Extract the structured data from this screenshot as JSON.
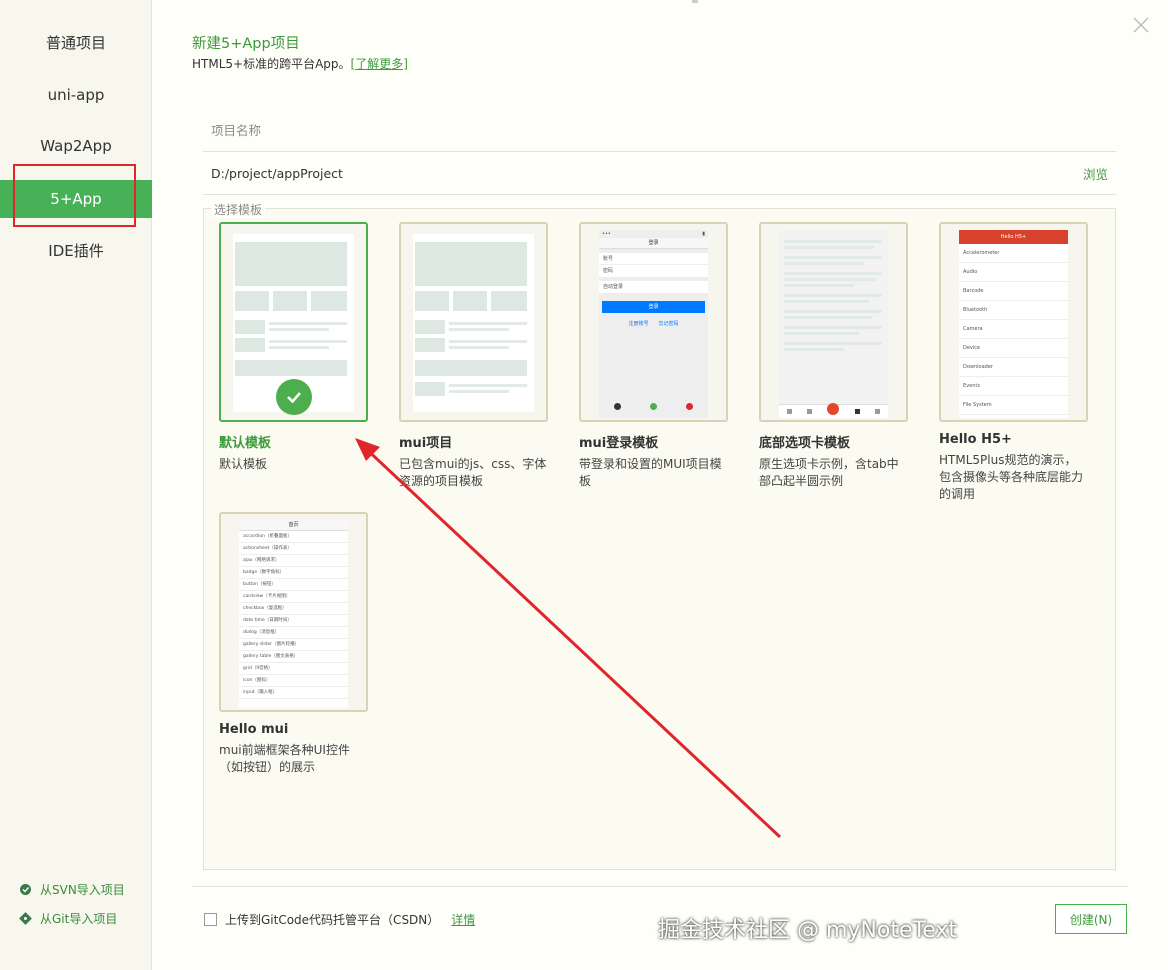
{
  "sidebar": {
    "items": [
      {
        "label": "普通项目"
      },
      {
        "label": "uni-app"
      },
      {
        "label": "Wap2App"
      },
      {
        "label": "5+App",
        "active": true
      },
      {
        "label": "IDE插件"
      }
    ],
    "imports": [
      {
        "label": "从SVN导入项目",
        "icon": "svn-icon"
      },
      {
        "label": "从Git导入项目",
        "icon": "git-icon"
      }
    ]
  },
  "header": {
    "title": "新建5+App项目",
    "subtitle": "HTML5+标准的跨平台App。",
    "learn_more": "[了解更多]"
  },
  "form": {
    "name_placeholder": "项目名称",
    "path_value": "D:/project/appProject",
    "browse_label": "浏览"
  },
  "templates": {
    "legend": "选择模板",
    "items": [
      {
        "name": "默认模板",
        "desc": "默认模板",
        "selected": true
      },
      {
        "name": "mui项目",
        "desc": "已包含mui的js、css、字体资源的项目模板"
      },
      {
        "name": "mui登录模板",
        "desc": "带登录和设置的MUI项目模板"
      },
      {
        "name": "底部选项卡模板",
        "desc": "原生选项卡示例，含tab中部凸起半圆示例"
      },
      {
        "name": "Hello H5+",
        "desc": "HTML5Plus规范的演示，包含摄像头等各种底层能力的调用"
      },
      {
        "name": "Hello mui",
        "desc": "mui前端框架各种UI控件（如按钮）的展示"
      }
    ],
    "login_thumb": {
      "title": "登录",
      "account": "账号",
      "password": "密码",
      "auto": "自动登录",
      "button": "登录",
      "register": "注册账号",
      "forgot": "忘记密码"
    },
    "h5_thumb": {
      "title": "Hello H5+",
      "rows": [
        "Accelerometer",
        "Audio",
        "Barcode",
        "Bluetooth",
        "Camera",
        "Device",
        "Downloader",
        "Events",
        "File System"
      ]
    },
    "mui_thumb": {
      "title": "首页",
      "rows": [
        "accordion（折叠面板）",
        "actionsheet（操作表）",
        "ajax（网络请求）",
        "badge（数字角标）",
        "button（按钮）",
        "cardview（卡片视图）",
        "checkbox（复选框）",
        "date time（日期时间）",
        "dialog（消息框）",
        "gallery slider（图片轮播）",
        "gallery table（图文表格）",
        "grid（9宫格）",
        "icon（图标）",
        "input（输入框）"
      ]
    }
  },
  "footer": {
    "gitcode_label": "上传到GitCode代码托管平台（CSDN）",
    "detail_link": "详情",
    "create_button": "创建(N)"
  },
  "watermark": "掘金技术社区 @ myNoteText",
  "colors": {
    "accent": "#47b157",
    "annotation": "#e0262b"
  }
}
